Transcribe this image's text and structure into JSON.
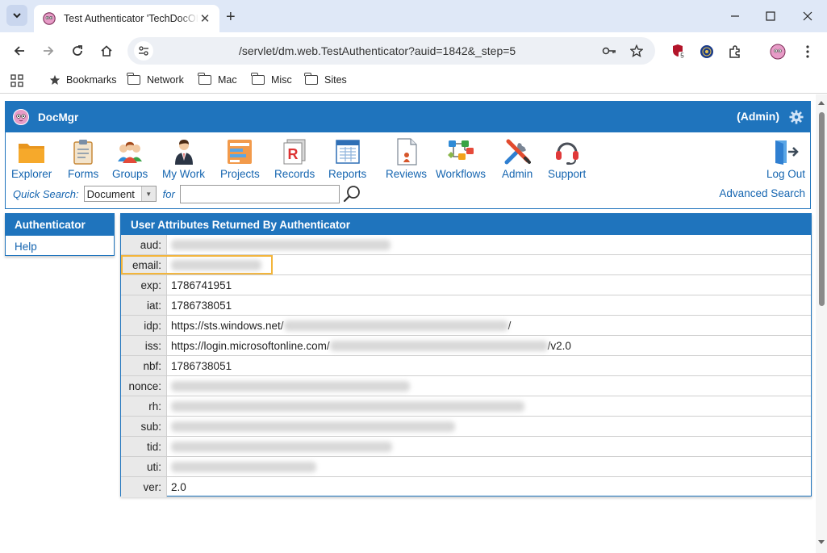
{
  "browser": {
    "tab_title": "Test Authenticator 'TechDocOIDC'",
    "url": "/servlet/dm.web.TestAuthenticator?auid=1842&_step=5",
    "extension_badge": "5",
    "bookmarks": [
      {
        "label": "Bookmarks",
        "icon": "star-icon"
      },
      {
        "label": "Network",
        "icon": "folder-icon"
      },
      {
        "label": "Mac",
        "icon": "folder-icon"
      },
      {
        "label": "Misc",
        "icon": "folder-icon"
      },
      {
        "label": "Sites",
        "icon": "folder-icon"
      }
    ]
  },
  "app": {
    "name": "DocMgr",
    "user_role": "(Admin)",
    "nav": [
      {
        "label": "Explorer",
        "icon": "folder-icon"
      },
      {
        "label": "Forms",
        "icon": "clipboard-icon"
      },
      {
        "label": "Groups",
        "icon": "group-icon"
      },
      {
        "label": "My Work",
        "icon": "person-icon"
      },
      {
        "label": "Projects",
        "icon": "project-icon"
      },
      {
        "label": "Records",
        "icon": "records-icon"
      },
      {
        "label": "Reports",
        "icon": "report-icon"
      },
      {
        "label": "Reviews",
        "icon": "review-icon"
      },
      {
        "label": "Workflows",
        "icon": "workflow-icon"
      },
      {
        "label": "Admin",
        "icon": "tools-icon"
      },
      {
        "label": "Support",
        "icon": "headset-icon"
      }
    ],
    "logout_label": "Log Out",
    "quick_search_label": "Quick Search:",
    "quick_search_type": "Document",
    "for_label": "for",
    "quick_search_value": "",
    "advanced_search_label": "Advanced Search"
  },
  "sidebar": {
    "title": "Authenticator",
    "items": [
      {
        "label": "Help"
      }
    ]
  },
  "attributes": {
    "title": "User Attributes Returned By Authenticator",
    "rows": [
      {
        "key": "aud:",
        "prefix": "",
        "suffix": "",
        "redacted": true
      },
      {
        "key": "email:",
        "prefix": "",
        "suffix": "",
        "redacted": true
      },
      {
        "key": "exp:",
        "prefix": "1786741951",
        "suffix": "",
        "redacted": false
      },
      {
        "key": "iat:",
        "prefix": "1786738051",
        "suffix": "",
        "redacted": false
      },
      {
        "key": "idp:",
        "prefix": "https://sts.windows.net/",
        "suffix": "/",
        "redacted": true
      },
      {
        "key": "iss:",
        "prefix": "https://login.microsoftonline.com/",
        "suffix": "/v2.0",
        "redacted": true
      },
      {
        "key": "nbf:",
        "prefix": "1786738051",
        "suffix": "",
        "redacted": false
      },
      {
        "key": "nonce:",
        "prefix": "",
        "suffix": "",
        "redacted": true
      },
      {
        "key": "rh:",
        "prefix": "",
        "suffix": "",
        "redacted": true
      },
      {
        "key": "sub:",
        "prefix": "",
        "suffix": "",
        "redacted": true
      },
      {
        "key": "tid:",
        "prefix": "",
        "suffix": "",
        "redacted": true
      },
      {
        "key": "uti:",
        "prefix": "",
        "suffix": "",
        "redacted": true
      },
      {
        "key": "ver:",
        "prefix": "2.0",
        "suffix": "",
        "redacted": false
      }
    ],
    "highlighted_row": "email:"
  },
  "colors": {
    "header_blue": "#1f74bd",
    "link_blue": "#1565b0",
    "highlight": "#f3b53b"
  }
}
